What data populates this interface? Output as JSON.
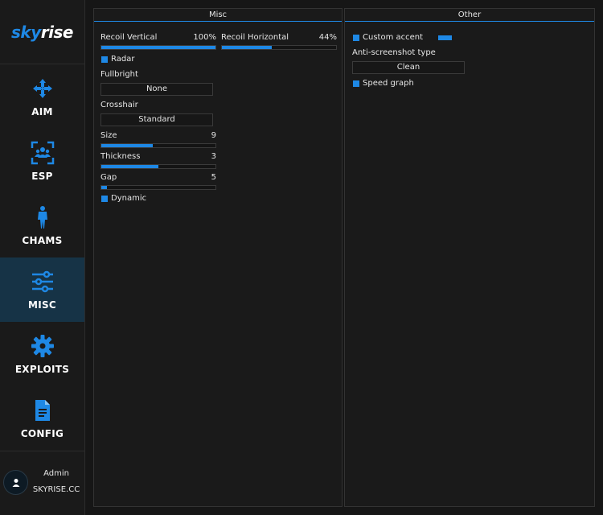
{
  "brand": {
    "part1": "sky",
    "part2": "rise"
  },
  "nav": [
    {
      "label": "AIM",
      "icon": "crosshair-arrows-icon"
    },
    {
      "label": "ESP",
      "icon": "people-scan-icon"
    },
    {
      "label": "CHAMS",
      "icon": "person-icon"
    },
    {
      "label": "MISC",
      "icon": "sliders-icon",
      "active": true
    },
    {
      "label": "EXPLOITS",
      "icon": "gear-icon"
    },
    {
      "label": "CONFIG",
      "icon": "document-icon"
    }
  ],
  "user": {
    "name": "Admin",
    "site": "SKYRISE.CC"
  },
  "accent": "#1e88e5",
  "misc": {
    "title": "Misc",
    "recoil_vertical": {
      "label": "Recoil Vertical",
      "value": "100%",
      "fraction": 1.0
    },
    "recoil_horizontal": {
      "label": "Recoil Horizontal",
      "value": "44%",
      "fraction": 0.44
    },
    "radar": {
      "label": "Radar",
      "checked": true
    },
    "fullbright": {
      "label": "Fullbright",
      "value": "None"
    },
    "crosshair": {
      "label": "Crosshair",
      "value": "Standard"
    },
    "size": {
      "label": "Size",
      "value": "9",
      "fraction": 0.45
    },
    "thickness": {
      "label": "Thickness",
      "value": "3",
      "fraction": 0.5
    },
    "gap": {
      "label": "Gap",
      "value": "5",
      "fraction": 0.05
    },
    "dynamic": {
      "label": "Dynamic",
      "checked": true
    }
  },
  "other": {
    "title": "Other",
    "custom_accent": {
      "label": "Custom accent",
      "checked": true,
      "color": "#1e88e5"
    },
    "anti_screenshot": {
      "label": "Anti-screenshot type",
      "value": "Clean"
    },
    "speed_graph": {
      "label": "Speed graph",
      "checked": true
    }
  }
}
